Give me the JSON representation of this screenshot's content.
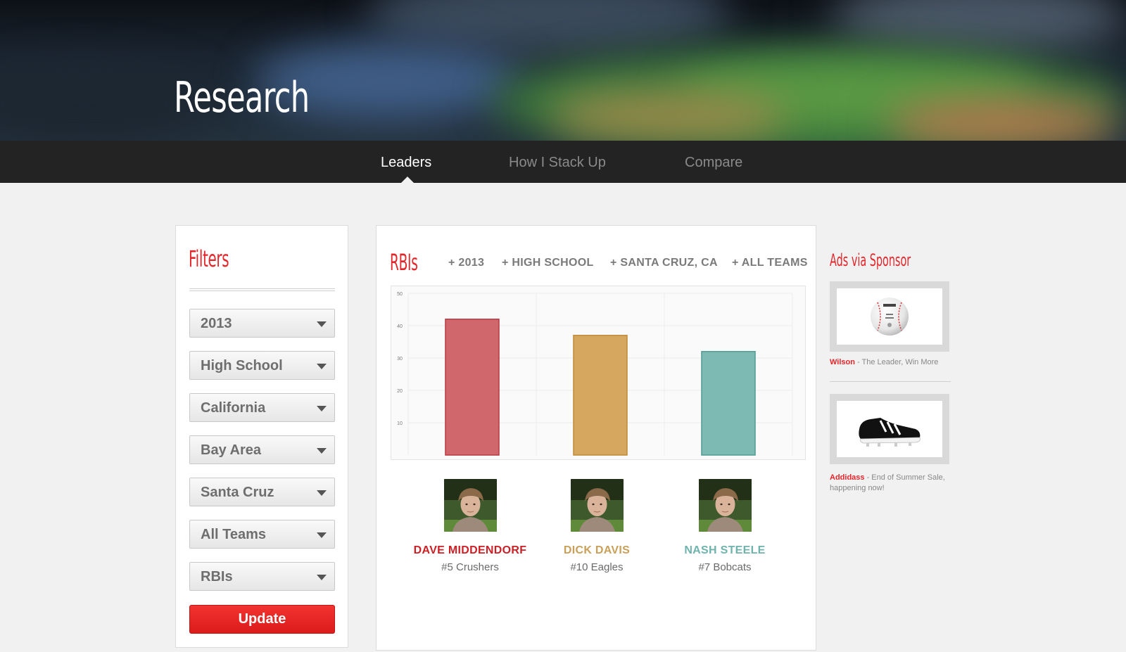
{
  "hero": {
    "title": "Research"
  },
  "nav": {
    "tabs": [
      {
        "label": "Leaders",
        "active": true
      },
      {
        "label": "How I Stack Up",
        "active": false
      },
      {
        "label": "Compare",
        "active": false
      }
    ]
  },
  "filters": {
    "title": "Filters",
    "selects": [
      "2013",
      "High School",
      "California",
      "Bay Area",
      "Santa Cruz",
      "All Teams",
      "RBIs"
    ],
    "update_label": "Update"
  },
  "main": {
    "title": "RBIs",
    "tags": [
      "+ 2013",
      "+ HIGH SCHOOL",
      "+ SANTA CRUZ, CA",
      "+ ALL TEAMS"
    ]
  },
  "chart_data": {
    "type": "bar",
    "categories": [
      "DAVE MIDDENDORF",
      "DICK DAVIS",
      "NASH STEELE"
    ],
    "values": [
      42,
      37,
      32
    ],
    "ylim": [
      0,
      50
    ],
    "yticks": [
      10,
      20,
      30,
      40,
      50
    ],
    "grid": true,
    "colors": [
      "#cf676c",
      "#d6a75f",
      "#7dbab4"
    ],
    "stroke_colors": [
      "#b83a44",
      "#bf8a35",
      "#4f9a92"
    ]
  },
  "players": [
    {
      "name": "DAVE MIDDENDORF",
      "team": "#5 Crushers",
      "color": "#cc1f26"
    },
    {
      "name": "DICK DAVIS",
      "team": "#10 Eagles",
      "color": "#c9a05a"
    },
    {
      "name": "NASH STEELE",
      "team": "#7 Bobcats",
      "color": "#6fb3ac"
    }
  ],
  "ads": {
    "title": "Ads via Sponsor",
    "items": [
      {
        "brand": "Wilson",
        "text": " - The Leader, Win More",
        "icon": "baseball-icon"
      },
      {
        "brand": "Addidass",
        "text": " - End of Summer Sale, happening now!",
        "icon": "cleat-icon"
      }
    ]
  }
}
